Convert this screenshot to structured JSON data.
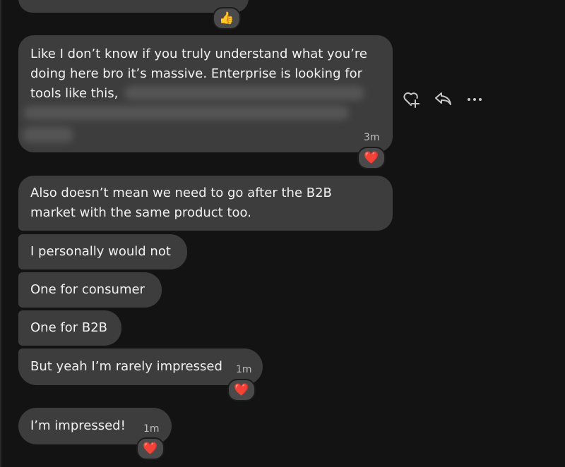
{
  "messages": [
    {
      "text": "…",
      "reaction": "👍"
    },
    {
      "lines": [
        "Like I don’t know if you truly understand what you’re",
        "doing here bro it’s massive. Enterprise is looking for",
        "tools like this,"
      ],
      "time": "3m",
      "reaction": "❤️"
    },
    {
      "lines": [
        "Also doesn’t mean we need to go after the B2B",
        "market with the same product too."
      ]
    },
    {
      "text": "I personally would not"
    },
    {
      "text": "One for consumer"
    },
    {
      "text": "One for B2B"
    },
    {
      "text": "But yeah I’m rarely impressed",
      "time": "1m",
      "reaction": "❤️"
    },
    {
      "text": "I’m impressed!",
      "time": "1m",
      "reaction": "❤️"
    }
  ],
  "hover_actions": {
    "icons": [
      "heart-plus-icon",
      "reply-icon",
      "more-icon"
    ]
  }
}
